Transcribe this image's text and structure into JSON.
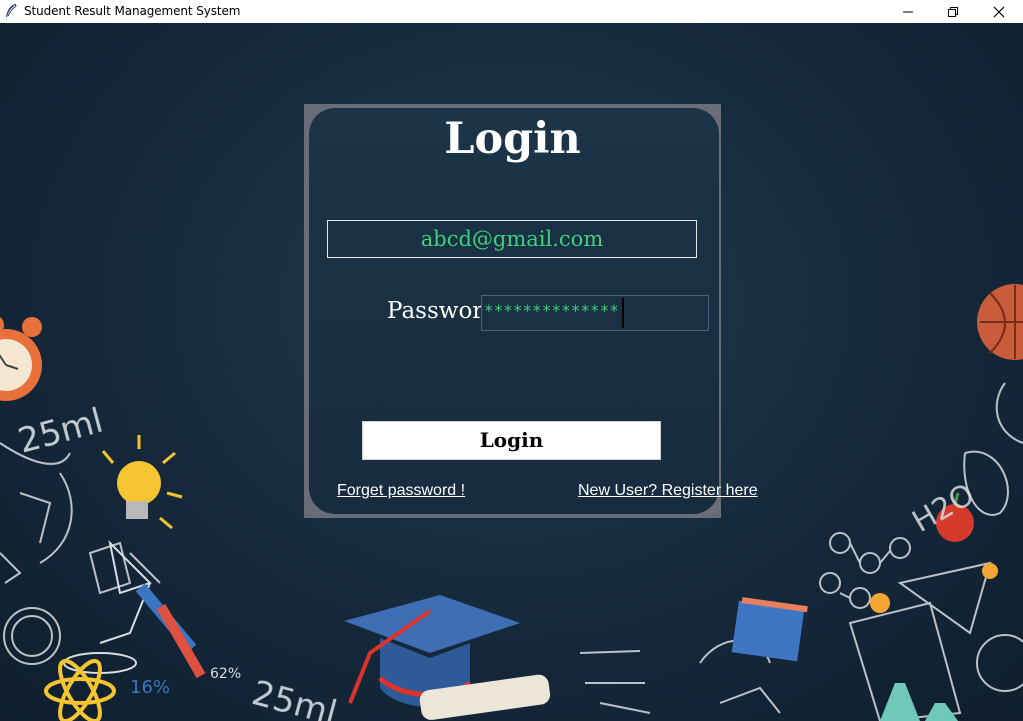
{
  "window": {
    "title": "Student Result Management System"
  },
  "login": {
    "heading": "Login",
    "email_value": "abcd@gmail.com",
    "password_label": "Password",
    "password_value": "**************",
    "login_button": "Login",
    "forget_link": "Forget password !",
    "register_link": "New User? Register here"
  },
  "background": {
    "labels": [
      "25ml",
      "25ml",
      "16%",
      "62%",
      "H2O"
    ]
  },
  "colors": {
    "board": "#15293b",
    "accent_text": "#3fd07a",
    "panel": "#1c3448",
    "panel_frame": "#6a6d78"
  }
}
